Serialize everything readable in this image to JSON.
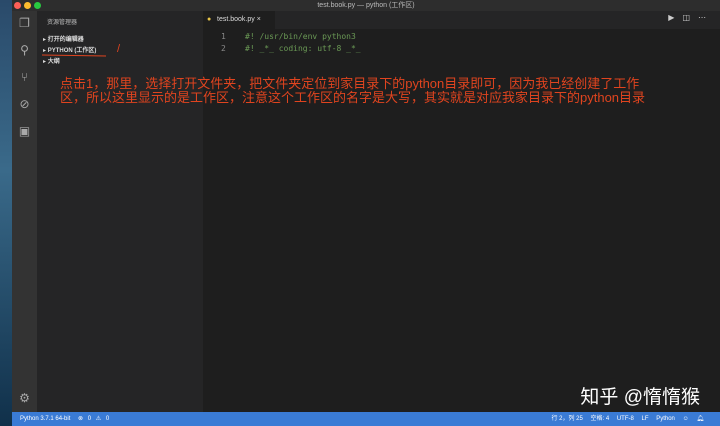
{
  "window": {
    "title": "test.book.py — python (工作区)"
  },
  "sidebar": {
    "title": "资源管理器",
    "sections": [
      {
        "label": "打开的编辑器"
      },
      {
        "label": "PYTHON (工作区)"
      },
      {
        "label": "大纲"
      }
    ]
  },
  "editor": {
    "tab": "test.book.py",
    "lines": [
      {
        "num": "1",
        "text": "#! /usr/bin/env python3"
      },
      {
        "num": "2",
        "text": "#! _*_ coding: utf-8 _*_"
      }
    ]
  },
  "annotation": {
    "mark": "/",
    "note": "点击1，那里，选择打开文件夹，把文件夹定位到家目录下的python目录即可，因为我已经创建了工作区，所以这里显示的是工作区，注意这个工作区的名字是大写，其实就是对应我家目录下的python目录"
  },
  "watermark": "知乎 @惰惰猴",
  "status": {
    "interpreter": "Python 3.7.1 64-bit",
    "errors": "0",
    "warnings": "0",
    "position": "行 2，列 25",
    "spaces": "空格: 4",
    "encoding": "UTF-8",
    "eol": "LF",
    "language": "Python"
  },
  "colors": {
    "statusbar": "#3a7bd5",
    "annotation": "#e0441f"
  }
}
